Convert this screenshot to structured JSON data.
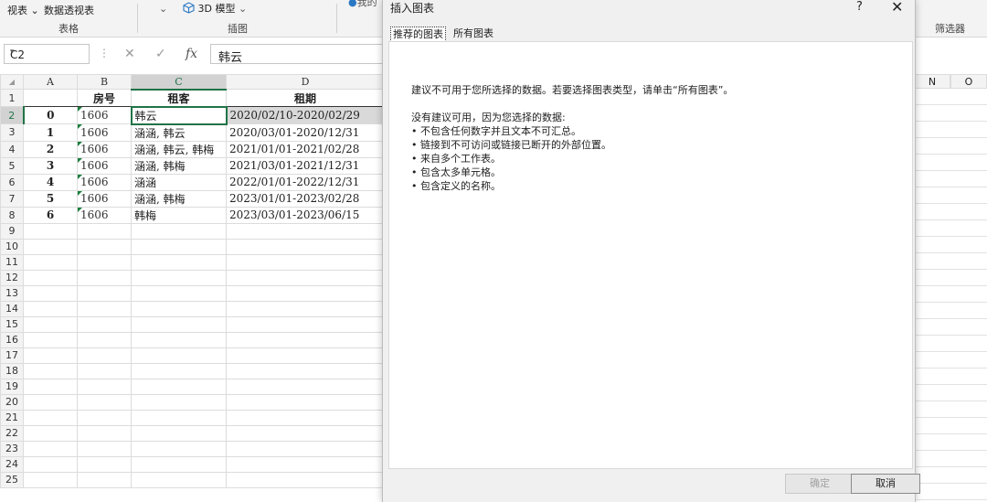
{
  "ribbon": {
    "views_label": "视表",
    "pivot_label": "数据透视表",
    "table_group": "表格",
    "model3d_label": "3D 模型",
    "illustration_group": "插图",
    "partial_label": "我的",
    "filter_group": "筛选器"
  },
  "formula_bar": {
    "name_box": "C2",
    "fx": "fx",
    "content": "韩云"
  },
  "columns": [
    "A",
    "B",
    "C",
    "D"
  ],
  "right_columns": [
    "N",
    "O"
  ],
  "headers": {
    "b": "房号",
    "c": "租客",
    "d": "租期"
  },
  "rows": [
    {
      "n": "1"
    },
    {
      "n": "2",
      "a": "0",
      "b": "1606",
      "c": "韩云",
      "d": "2020/02/10-2020/02/29"
    },
    {
      "n": "3",
      "a": "1",
      "b": "1606",
      "c": "涵涵, 韩云",
      "d": "2020/03/01-2020/12/31"
    },
    {
      "n": "4",
      "a": "2",
      "b": "1606",
      "c": "涵涵, 韩云, 韩梅",
      "d": "2021/01/01-2021/02/28"
    },
    {
      "n": "5",
      "a": "3",
      "b": "1606",
      "c": "涵涵, 韩梅",
      "d": "2021/03/01-2021/12/31"
    },
    {
      "n": "6",
      "a": "4",
      "b": "1606",
      "c": "涵涵",
      "d": "2022/01/01-2022/12/31"
    },
    {
      "n": "7",
      "a": "5",
      "b": "1606",
      "c": "涵涵, 韩梅",
      "d": "2023/01/01-2023/02/28"
    },
    {
      "n": "8",
      "a": "6",
      "b": "1606",
      "c": "韩梅",
      "d": "2023/03/01-2023/06/15"
    }
  ],
  "empty_rows": [
    "9",
    "10",
    "11",
    "12",
    "13",
    "14",
    "15",
    "16",
    "17",
    "18",
    "19",
    "20",
    "21",
    "22",
    "23",
    "24",
    "25"
  ],
  "dialog": {
    "title": "插入图表",
    "help": "?",
    "close": "✕",
    "tabs": [
      "推荐的图表",
      "所有图表"
    ],
    "message": "建议不可用于您所选择的数据。若要选择图表类型，请单击“所有图表”。",
    "reason_title": "没有建议可用，因为您选择的数据:",
    "reasons": [
      "• 不包含任何数字并且文本不可汇总。",
      "• 链接到不可访问或链接已断开的外部位置。",
      "• 来自多个工作表。",
      "• 包含太多单元格。",
      "• 包含定义的名称。"
    ],
    "ok": "确定",
    "cancel": "取消"
  },
  "colors": {
    "accent": "#217346",
    "selection": "#d9d9d9"
  }
}
